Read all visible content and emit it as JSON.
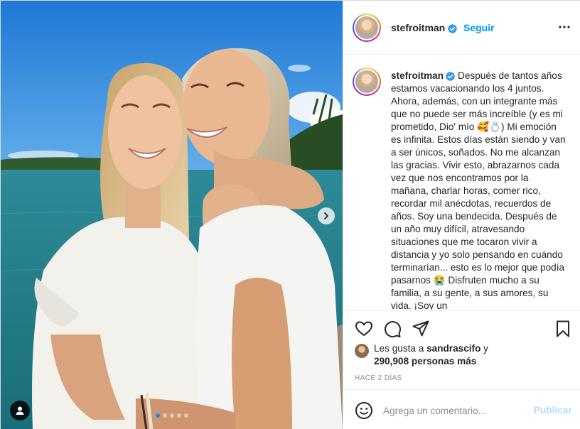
{
  "post": {
    "username": "stefroitman",
    "follow_label": "Seguir",
    "caption_user": "stefroitman",
    "caption_text": "Después de tantos años estamos vacacionando los 4 juntos. Ahora, además, con un integrante más que no puede ser más increíble (y es mi prometido, Dio' mío 🥰💍) Mi emoción es infinita. Estos días están siendo y van a ser únicos, soñados. No me alcanzan las gracias. Vivir esto, abrazarnos cada vez que nos encontramos por la mañana, charlar horas, comer rico, recordar mil anécdotas, recuerdos de años. Soy una bendecida. Después de un año muy difícil, atravesando situaciones que me tocaron vivir a distancia y yo solo pensando en cuándo terminarían... esto es lo mejor que podía pasarnos 😭 Disfruten mucho a su familia, a su gente, a sus amores, su vida. ¡Soy un",
    "likes_prefix": "Les gusta a",
    "likes_user": "sandrascifo",
    "likes_connector": "y",
    "likes_count": "290,908 personas más",
    "time_ago": "HACE 2 DÍAS",
    "comment_placeholder": "Agrega un comentario...",
    "publish_label": "Publicar"
  },
  "carousel": {
    "total": 5,
    "active_index": 0
  },
  "colors": {
    "accent": "#0095f6",
    "publish_disabled": "#b2dffc",
    "text": "#262626",
    "muted": "#8e8e8e",
    "border": "#efefef"
  },
  "icons": {
    "header_more": "more-horizontal-icon",
    "verified": "verified-badge-icon",
    "like": "heart-icon",
    "comment": "comment-bubble-icon",
    "share": "paper-plane-icon",
    "save": "bookmark-icon",
    "emoji": "smiley-icon",
    "next": "chevron-right-icon",
    "tag": "user-tag-icon"
  }
}
